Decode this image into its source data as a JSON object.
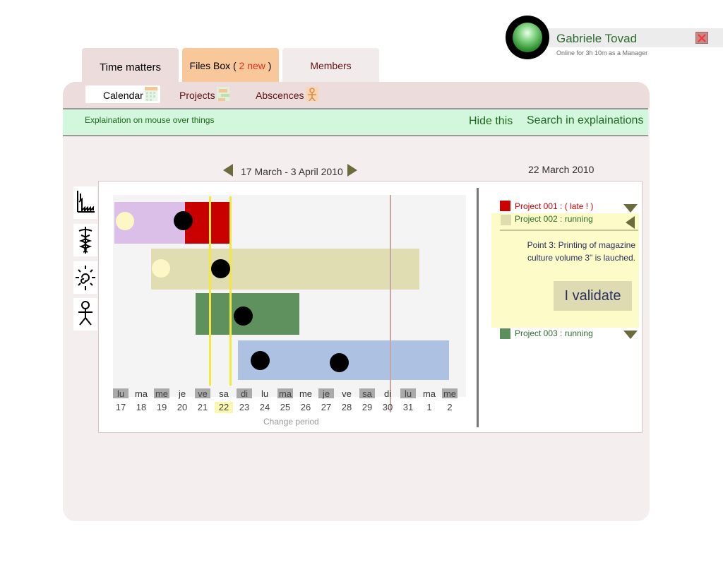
{
  "user": {
    "name": "Gabriele Tovad",
    "status": "Online for 3h 10m    as a Manager"
  },
  "top_tabs": {
    "time_matters": "Time matters",
    "files_box_prefix": "Files Box (",
    "files_box_new": " 2 new",
    "files_box_suffix": " )",
    "members": "Members"
  },
  "sub_tabs": {
    "calendar": "Calendar",
    "projects": "Projects",
    "absences": "Abscences"
  },
  "explain_bar": {
    "text": "Explaination on mouse over things",
    "hide": "Hide this",
    "search": "Search in explainations"
  },
  "calendar": {
    "period": "17 March - 3 April 2010",
    "current_date": "22 March 2010",
    "change_period": "Change period",
    "days": [
      {
        "label": "lu",
        "num": "17",
        "grey": true
      },
      {
        "label": "ma",
        "num": "18",
        "grey": false
      },
      {
        "label": "me",
        "num": "19",
        "grey": true
      },
      {
        "label": "je",
        "num": "20",
        "grey": false
      },
      {
        "label": "ve",
        "num": "21",
        "grey": true
      },
      {
        "label": "sa",
        "num": "22",
        "grey": false,
        "today": true
      },
      {
        "label": "di",
        "num": "23",
        "grey": true
      },
      {
        "label": "lu",
        "num": "24",
        "grey": false
      },
      {
        "label": "ma",
        "num": "25",
        "grey": true
      },
      {
        "label": "me",
        "num": "26",
        "grey": false
      },
      {
        "label": "je",
        "num": "27",
        "grey": true
      },
      {
        "label": "ve",
        "num": "28",
        "grey": false
      },
      {
        "label": "sa",
        "num": "29",
        "grey": true
      },
      {
        "label": "di",
        "num": "30",
        "grey": false
      },
      {
        "label": "lu",
        "num": "31",
        "grey": true
      },
      {
        "label": "ma",
        "num": "1",
        "grey": false
      },
      {
        "label": "me",
        "num": "2",
        "grey": true
      }
    ]
  },
  "projects": [
    {
      "label": "Project 001 : ( late ! )",
      "color": "#cc0000",
      "text_color": "#cc0000"
    },
    {
      "label": "Project 002 : running",
      "color": "#e0dcb0",
      "text_color": "#2f6a2f"
    },
    {
      "label": "Project 003 : running",
      "color": "#5b8f5b",
      "text_color": "#2f6a2f"
    }
  ],
  "detail": {
    "text": "Point 3: Printing of magazine culture volume 3\" is lauched.",
    "validate": "I validate"
  }
}
